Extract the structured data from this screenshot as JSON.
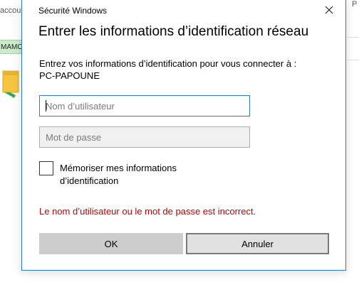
{
  "background": {
    "top_text": "accou",
    "green_label": "MAMO",
    "right_letter": "P"
  },
  "dialog": {
    "window_title": "Sécurité Windows",
    "heading": "Entrer les informations d’identification réseau",
    "prompt": "Entrez vos informations d’identification pour vous connecter à :",
    "target": "PC-PAPOUNE",
    "username": {
      "value": "",
      "placeholder": "Nom d’utilisateur"
    },
    "password": {
      "value": "",
      "placeholder": "Mot de passe"
    },
    "remember": {
      "label": "Mémoriser mes informations d’identification",
      "checked": false
    },
    "error": "Le nom d’utilisateur ou le mot de passe est incorrect.",
    "buttons": {
      "ok": "OK",
      "cancel": "Annuler"
    },
    "colors": {
      "accent": "#2b79d0",
      "error": "#c00000"
    }
  }
}
